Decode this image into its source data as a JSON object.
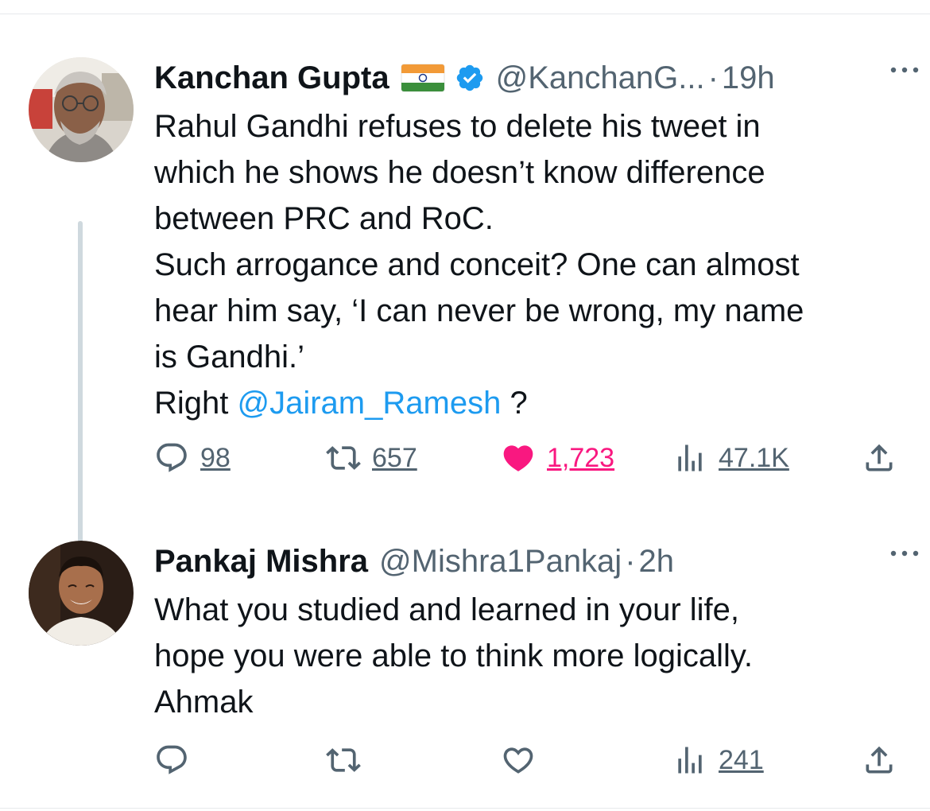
{
  "tweets": [
    {
      "author_name": "Kanchan Gupta",
      "handle": "@KanchanG...",
      "separator": "·",
      "time": "19h",
      "body_lines": [
        "Rahul Gandhi refuses to delete his tweet in",
        "which he shows he doesn’t know difference",
        "between PRC and RoC.",
        "Such arrogance and conceit? One can almost",
        "hear him say, ‘I can never be wrong, my name",
        "is Gandhi.’"
      ],
      "last_line_prefix": "Right ",
      "mention": "@Jairam_Ramesh",
      "last_line_suffix": " ?",
      "replies": "98",
      "retweets": "657",
      "likes": "1,723",
      "views": "47.1K",
      "liked": true
    },
    {
      "author_name": "Pankaj Mishra",
      "handle": "@Mishra1Pankaj",
      "separator": "·",
      "time": "2h",
      "body_lines": [
        "What you studied and learned in your life,",
        "hope you were able to think more logically.",
        "Ahmak"
      ],
      "views": "241"
    }
  ],
  "icons": {
    "reply": "reply-icon",
    "retweet": "retweet-icon",
    "like": "heart-icon",
    "views": "views-icon",
    "share": "share-icon",
    "more": "more-icon",
    "verified": "verified-badge-icon",
    "flag": "india-flag-icon"
  },
  "colors": {
    "text": "#0f1419",
    "secondary": "#536471",
    "link": "#1d9bf0",
    "like": "#f91880",
    "verified": "#1d9bf0"
  }
}
